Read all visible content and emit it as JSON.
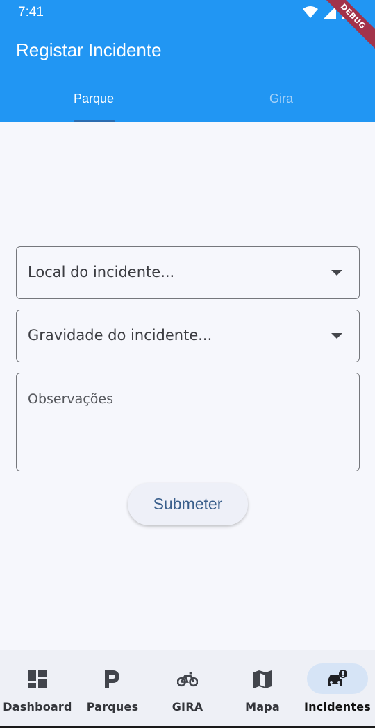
{
  "status_bar": {
    "time": "7:41",
    "icons": [
      "wifi-icon",
      "signal-icon",
      "battery-icon"
    ]
  },
  "debug_banner": "DEBUG",
  "app_bar": {
    "title": "Registar Incidente",
    "background_color": "#2196f3"
  },
  "tabs": [
    {
      "label": "Parque",
      "active": true
    },
    {
      "label": "Gira",
      "active": false
    }
  ],
  "form": {
    "location_dropdown": {
      "placeholder": "Local do incidente..."
    },
    "severity_dropdown": {
      "placeholder": "Gravidade do incidente..."
    },
    "observations": {
      "placeholder": "Observações",
      "value": ""
    },
    "submit_label": "Submeter"
  },
  "bottom_nav": {
    "items": [
      {
        "label": "Dashboard",
        "icon": "dashboard-icon",
        "active": false
      },
      {
        "label": "Parques",
        "icon": "parking-icon",
        "active": false
      },
      {
        "label": "GIRA",
        "icon": "bike-icon",
        "active": false
      },
      {
        "label": "Mapa",
        "icon": "map-icon",
        "active": false
      },
      {
        "label": "Incidentes",
        "icon": "car-alert-icon",
        "active": true
      }
    ]
  }
}
